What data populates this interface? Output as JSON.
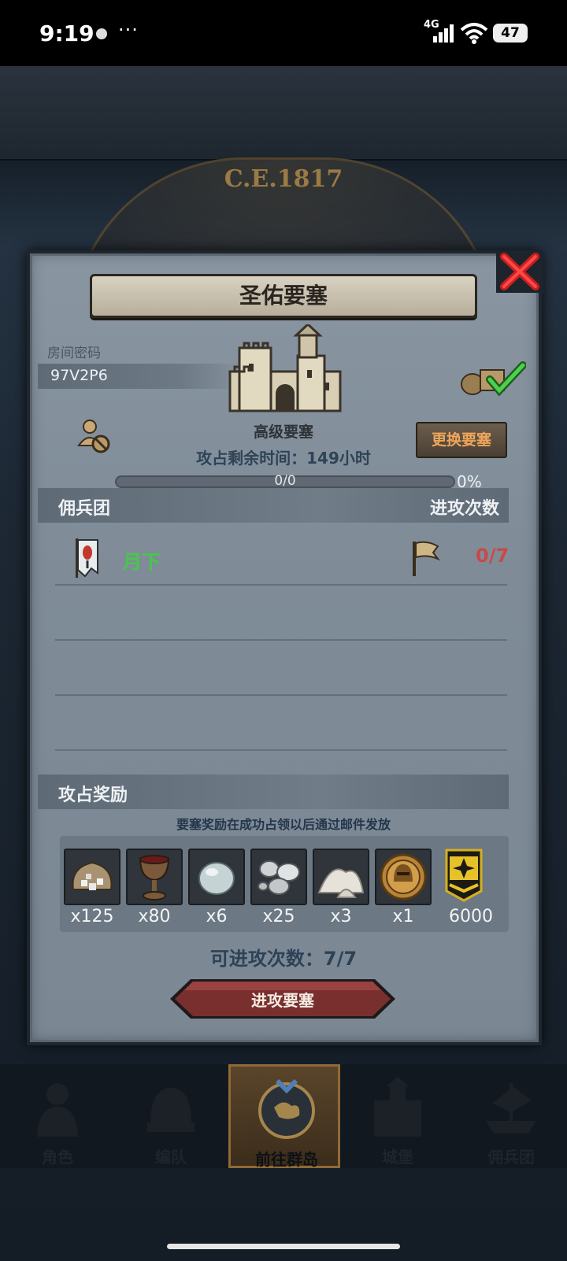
{
  "status_bar": {
    "time": "9:19",
    "more": "···",
    "network": "4G",
    "battery": "47"
  },
  "background": {
    "era": "C.E.1817"
  },
  "dialog": {
    "title": "圣佑要塞",
    "room_code_label": "房间密码",
    "room_code": "97V2P6",
    "fortress_type": "高级要塞",
    "change_button": "更换要塞",
    "time_remaining_label": "攻占剩余时间：",
    "time_remaining_value": "149",
    "time_remaining_unit": "小时",
    "progress_text": "0/0",
    "progress_percent": "0%",
    "progress_fraction": 0,
    "mercenary_header": "佣兵团",
    "attack_count_header": "进攻次数",
    "mercenaries": [
      {
        "name": "月下",
        "attacks": "0/7"
      }
    ],
    "rewards_header": "攻占奖励",
    "reward_note": "要塞奖励在成功占领以后通过邮件发放",
    "rewards": [
      {
        "icon": "ore-sack-icon",
        "count": "x125"
      },
      {
        "icon": "goblet-icon",
        "count": "x80"
      },
      {
        "icon": "moonstone-icon",
        "count": "x6"
      },
      {
        "icon": "silver-pile-icon",
        "count": "x25"
      },
      {
        "icon": "salt-pile-icon",
        "count": "x3"
      },
      {
        "icon": "helmet-medal-icon",
        "count": "x1"
      },
      {
        "icon": "honor-rank-icon",
        "count": "6000"
      }
    ],
    "attacks_available_label": "可进攻次数：",
    "attacks_available": "7/7",
    "attack_button": "进攻要塞"
  },
  "bottom_nav": {
    "tabs": [
      {
        "label": "角色"
      },
      {
        "label": "编队"
      },
      {
        "label": "前往群岛"
      },
      {
        "label": "城堡"
      },
      {
        "label": "佣兵团"
      }
    ],
    "active": "前往群岛"
  },
  "colors": {
    "merc_name": "#46c84a",
    "attack_count": "#c8494a",
    "change_button_text": "#f1a65b",
    "attack_button": "#7a2f2f"
  }
}
